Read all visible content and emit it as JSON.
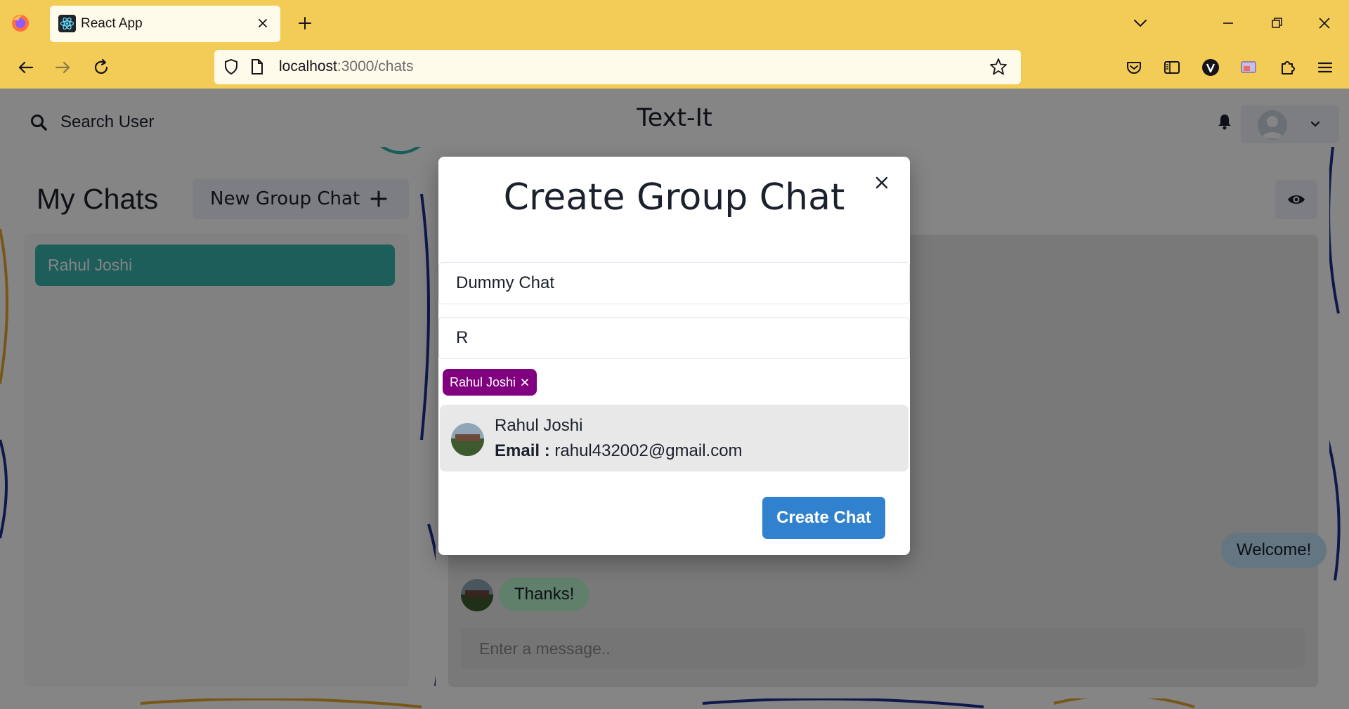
{
  "browser": {
    "tab_title": "React App",
    "url_host": "localhost",
    "url_rest": ":3000/chats",
    "colors": {
      "chrome": "#f3cb57",
      "field": "#fffbea"
    }
  },
  "header": {
    "search_label": "Search User",
    "brand": "Text-It"
  },
  "sidebar": {
    "title": "My Chats",
    "new_group_label": "New Group Chat",
    "chats": [
      {
        "label": "Rahul Joshi"
      }
    ],
    "accent": "#38b2ac"
  },
  "chat": {
    "messages": [
      {
        "text": "Welcome!",
        "side": "right",
        "color": "#bee3f8"
      },
      {
        "text": "Thanks!",
        "side": "left",
        "color": "#b9f5d0"
      }
    ],
    "input_placeholder": "Enter a message.."
  },
  "modal": {
    "title": "Create Group Chat",
    "chat_name_value": "Dummy Chat",
    "users_value": "R",
    "selected_users": [
      {
        "label": "Rahul Joshi",
        "color": "#800080"
      }
    ],
    "results": [
      {
        "name": "Rahul Joshi",
        "email_label": "Email :",
        "email": "rahul432002@gmail.com"
      }
    ],
    "create_label": "Create Chat",
    "create_color": "#3182ce"
  }
}
